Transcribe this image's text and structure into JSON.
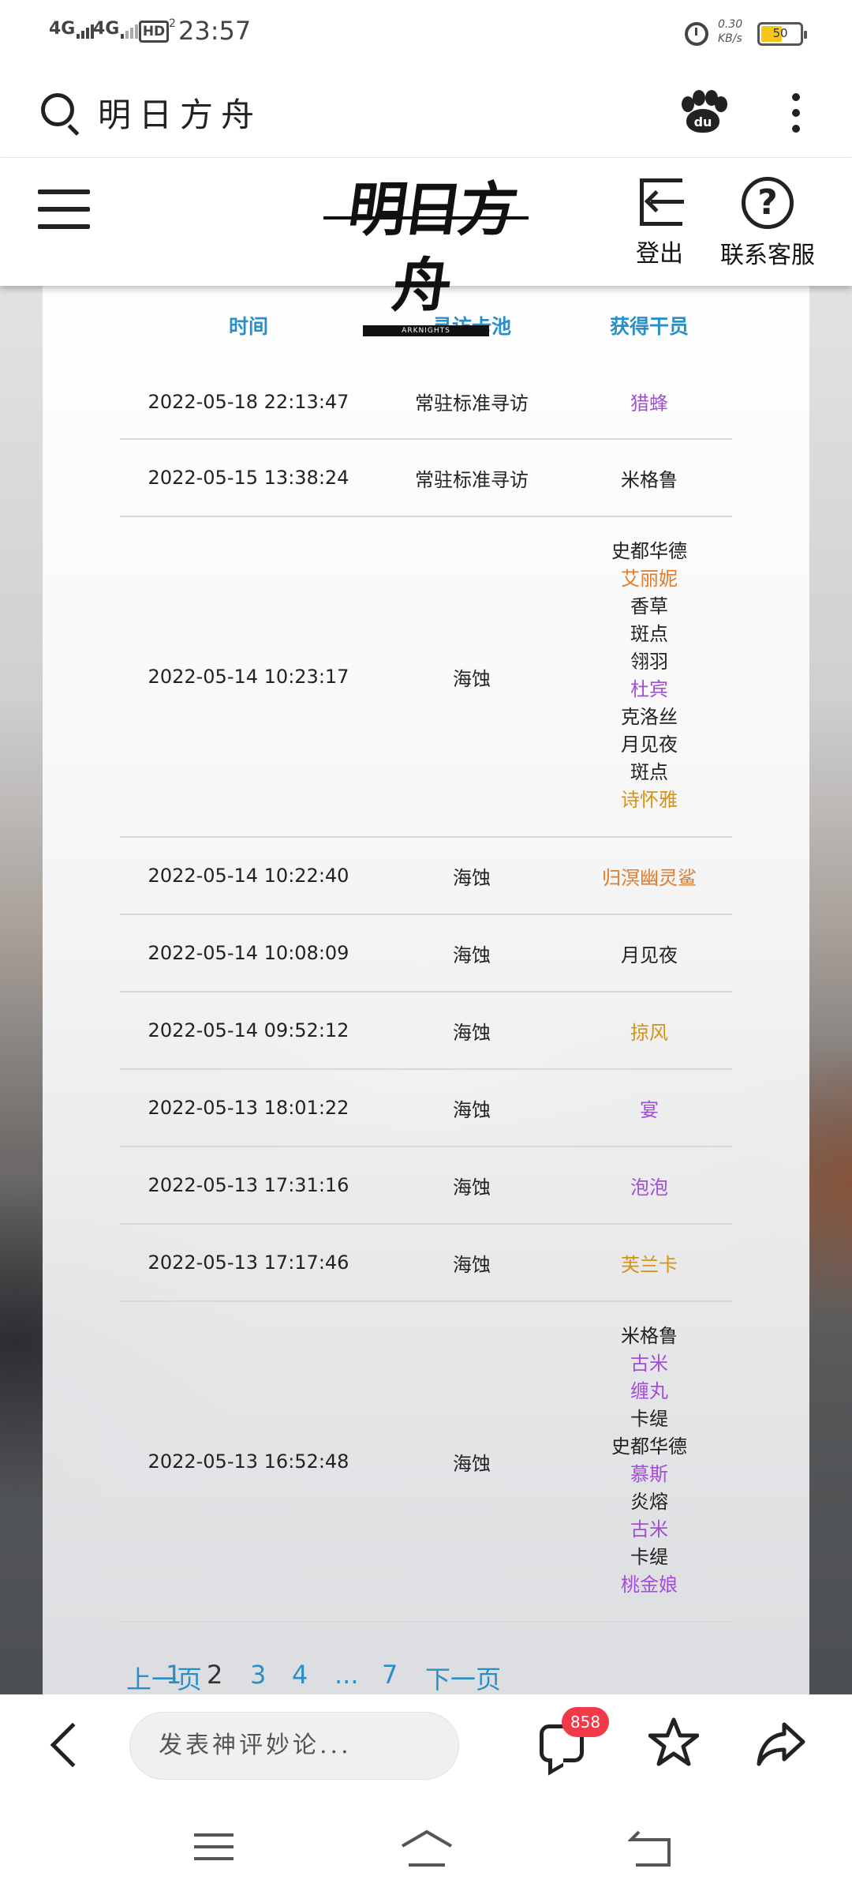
{
  "status_bar": {
    "signal_1": "4G",
    "signal_2": "4G",
    "hd_label": "HD",
    "hd_sub": "2",
    "time": "23:57",
    "net_speed_value": "0.30",
    "net_speed_unit": "KB/s",
    "battery_level": "50"
  },
  "browser": {
    "search_query": "明日方舟",
    "search_icon": "search-icon",
    "baidu_icon": "baidu-paw-icon",
    "more_icon": "more-vertical-icon"
  },
  "site_header": {
    "logo_text": "明日方舟",
    "logo_sub": "ARKNIGHTS",
    "logout_label": "登出",
    "support_label": "联系客服"
  },
  "table": {
    "headers": [
      "时间",
      "寻访卡池",
      "获得干员"
    ],
    "rows": [
      {
        "time": "2022-05-18 22:13:47",
        "pool": "常驻标准寻访",
        "operators": [
          {
            "name": "猎蜂",
            "rarity_color": "purple"
          }
        ]
      },
      {
        "time": "2022-05-15 13:38:24",
        "pool": "常驻标准寻访",
        "operators": [
          {
            "name": "米格鲁",
            "rarity_color": "black"
          }
        ]
      },
      {
        "time": "2022-05-14 10:23:17",
        "pool": "海蚀",
        "operators": [
          {
            "name": "史都华德",
            "rarity_color": "black"
          },
          {
            "name": "艾丽妮",
            "rarity_color": "orange"
          },
          {
            "name": "香草",
            "rarity_color": "black"
          },
          {
            "name": "斑点",
            "rarity_color": "black"
          },
          {
            "name": "翎羽",
            "rarity_color": "black"
          },
          {
            "name": "杜宾",
            "rarity_color": "purple"
          },
          {
            "name": "克洛丝",
            "rarity_color": "black"
          },
          {
            "name": "月见夜",
            "rarity_color": "black"
          },
          {
            "name": "斑点",
            "rarity_color": "black"
          },
          {
            "name": "诗怀雅",
            "rarity_color": "gold"
          }
        ]
      },
      {
        "time": "2022-05-14 10:22:40",
        "pool": "海蚀",
        "operators": [
          {
            "name": "归溟幽灵鲨",
            "rarity_color": "orange"
          }
        ]
      },
      {
        "time": "2022-05-14 10:08:09",
        "pool": "海蚀",
        "operators": [
          {
            "name": "月见夜",
            "rarity_color": "black"
          }
        ]
      },
      {
        "time": "2022-05-14 09:52:12",
        "pool": "海蚀",
        "operators": [
          {
            "name": "掠风",
            "rarity_color": "gold"
          }
        ]
      },
      {
        "time": "2022-05-13 18:01:22",
        "pool": "海蚀",
        "operators": [
          {
            "name": "宴",
            "rarity_color": "purple"
          }
        ]
      },
      {
        "time": "2022-05-13 17:31:16",
        "pool": "海蚀",
        "operators": [
          {
            "name": "泡泡",
            "rarity_color": "purple"
          }
        ]
      },
      {
        "time": "2022-05-13 17:17:46",
        "pool": "海蚀",
        "operators": [
          {
            "name": "芙兰卡",
            "rarity_color": "gold"
          }
        ]
      },
      {
        "time": "2022-05-13 16:52:48",
        "pool": "海蚀",
        "operators": [
          {
            "name": "米格鲁",
            "rarity_color": "black"
          },
          {
            "name": "古米",
            "rarity_color": "purple"
          },
          {
            "name": "缠丸",
            "rarity_color": "purple"
          },
          {
            "name": "卡缇",
            "rarity_color": "black"
          },
          {
            "name": "史都华德",
            "rarity_color": "black"
          },
          {
            "name": "慕斯",
            "rarity_color": "purple"
          },
          {
            "name": "炎熔",
            "rarity_color": "black"
          },
          {
            "name": "古米",
            "rarity_color": "purple"
          },
          {
            "name": "卡缇",
            "rarity_color": "black"
          },
          {
            "name": "桃金娘",
            "rarity_color": "purple"
          }
        ]
      }
    ]
  },
  "pagination": {
    "prev": "上一页",
    "pages": [
      "1",
      "2",
      "3",
      "4",
      "...",
      "7"
    ],
    "current": "2",
    "next": "下一页"
  },
  "bottom_bar": {
    "comment_placeholder": "发表神评妙论...",
    "comment_count": "858"
  },
  "colors": {
    "header_blue": "#2b8fc7",
    "rarity_purple": "#a24fd6",
    "rarity_orange": "#e07b2b",
    "rarity_gold": "#d39318",
    "badge_red": "#f3384a"
  }
}
